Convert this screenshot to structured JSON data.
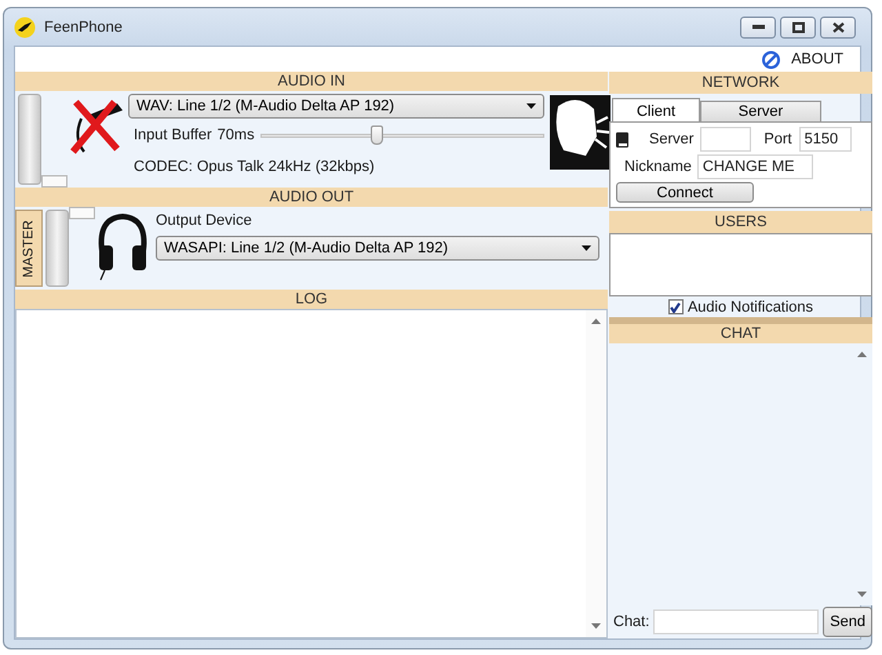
{
  "window": {
    "title": "FeenPhone"
  },
  "menu": {
    "about": "ABOUT"
  },
  "audio_in": {
    "title": "AUDIO IN",
    "muted": true,
    "level": 0,
    "device": "WAV: Line 1/2 (M-Audio Delta AP 192)",
    "buffer_label": "Input Buffer",
    "buffer_value": "70ms",
    "buffer": {
      "level": 0.41
    },
    "codec": "CODEC: Opus Talk 24kHz (32kbps)"
  },
  "audio_out": {
    "title": "AUDIO OUT",
    "tab": "MASTER",
    "level": 1,
    "device_label": "Output Device",
    "device": "WASAPI: Line 1/2 (M-Audio Delta AP 192)"
  },
  "log": {
    "title": "LOG"
  },
  "network": {
    "title": "NETWORK",
    "tabs": [
      {
        "label": "Client",
        "selected": true
      },
      {
        "label": "Server",
        "selected": false
      }
    ],
    "server_label": "Server",
    "port_label": "Port",
    "port": "5150",
    "nickname_label": "Nickname",
    "nickname": "CHANGE ME",
    "connect": "Connect"
  },
  "users": {
    "title": "USERS"
  },
  "notifications": {
    "label": "Audio Notifications",
    "checked": true
  },
  "chat": {
    "title": "CHAT",
    "input_label": "Chat:",
    "send": "Send"
  }
}
